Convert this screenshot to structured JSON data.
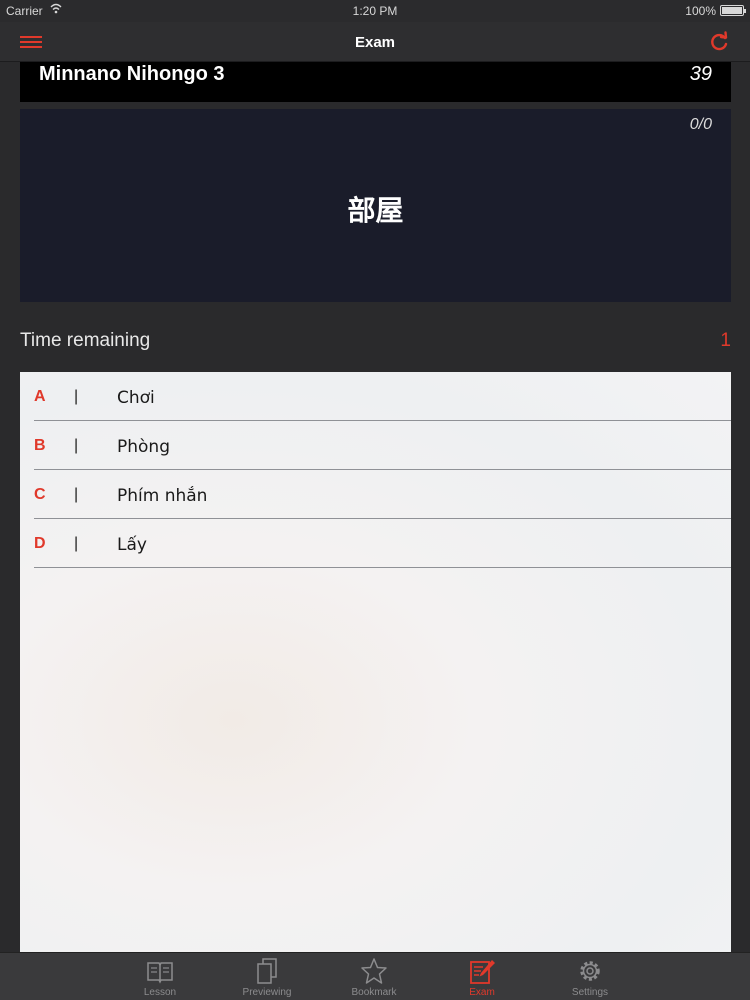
{
  "status_bar": {
    "carrier": "Carrier",
    "time": "1:20 PM",
    "battery": "100%",
    "battery_level": 1.0
  },
  "nav": {
    "title": "Exam",
    "menu_icon": "menu-icon",
    "refresh_icon": "refresh-icon"
  },
  "lesson": {
    "name": "Minnano Nihongo 3",
    "count": "39"
  },
  "question": {
    "progress": "0/0",
    "word": "部屋"
  },
  "timer": {
    "label": "Time remaining",
    "value": "1"
  },
  "answers": [
    {
      "letter": "A",
      "separator": "|",
      "text": "Chơi"
    },
    {
      "letter": "B",
      "separator": "|",
      "text": "Phòng"
    },
    {
      "letter": "C",
      "separator": "|",
      "text": "Phím nhắn"
    },
    {
      "letter": "D",
      "separator": "|",
      "text": "Lấy"
    }
  ],
  "tabs": [
    {
      "label": "Lesson",
      "icon": "book-icon",
      "active": false
    },
    {
      "label": "Previewing",
      "icon": "pages-icon",
      "active": false
    },
    {
      "label": "Bookmark",
      "icon": "star-icon",
      "active": false
    },
    {
      "label": "Exam",
      "icon": "exam-icon",
      "active": true
    },
    {
      "label": "Settings",
      "icon": "gear-icon",
      "active": false
    }
  ],
  "colors": {
    "accent": "#e0392b",
    "nav_bg": "#2e2e30",
    "card_bg": "#1a1c2a",
    "tab_inactive": "#8c8c8e"
  }
}
